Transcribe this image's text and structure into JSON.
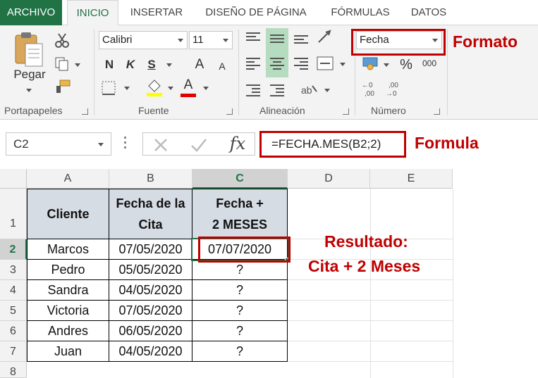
{
  "tabs": [
    "ARCHIVO",
    "INICIO",
    "INSERTAR",
    "DISEÑO DE PÁGINA",
    "FÓRMULAS",
    "DATOS"
  ],
  "ribbon": {
    "clipboard": {
      "paste_label": "Pegar",
      "group_label": "Portapapeles"
    },
    "font": {
      "font_name": "Calibri",
      "font_size": "11",
      "bold": "N",
      "italic": "K",
      "underline": "S",
      "grow": "A",
      "shrink": "A",
      "color_letter": "A",
      "group_label": "Fuente"
    },
    "alignment": {
      "group_label": "Alineación"
    },
    "number": {
      "format": "Fecha",
      "percent": "%",
      "thousands": "000",
      "group_label": "Número"
    },
    "accent_color": "#217346",
    "highlight_color": "#c00000"
  },
  "formula_bar": {
    "name_box": "C2",
    "fx": "fx",
    "formula": "=FECHA.MES(B2;2)"
  },
  "annotations": {
    "formato": "Formato",
    "formula": "Formula",
    "resultado_line1": "Resultado:",
    "resultado_line2": "Cita + 2 Meses"
  },
  "sheet": {
    "columns": [
      "A",
      "B",
      "C",
      "D",
      "E"
    ],
    "rows": [
      "1",
      "2",
      "3",
      "4",
      "5",
      "6",
      "7",
      "8"
    ],
    "headers": {
      "a": "Cliente",
      "b_line1": "Fecha de la",
      "b_line2": "Cita",
      "c_line1": "Fecha +",
      "c_line2": "2 MESES"
    },
    "data": [
      {
        "cliente": "Marcos",
        "fecha": "07/05/2020",
        "resultado": "07/07/2020"
      },
      {
        "cliente": "Pedro",
        "fecha": "05/05/2020",
        "resultado": "?"
      },
      {
        "cliente": "Sandra",
        "fecha": "04/05/2020",
        "resultado": "?"
      },
      {
        "cliente": "Victoria",
        "fecha": "07/05/2020",
        "resultado": "?"
      },
      {
        "cliente": "Andres",
        "fecha": "06/05/2020",
        "resultado": "?"
      },
      {
        "cliente": "Juan",
        "fecha": "04/05/2020",
        "resultado": "?"
      }
    ]
  }
}
